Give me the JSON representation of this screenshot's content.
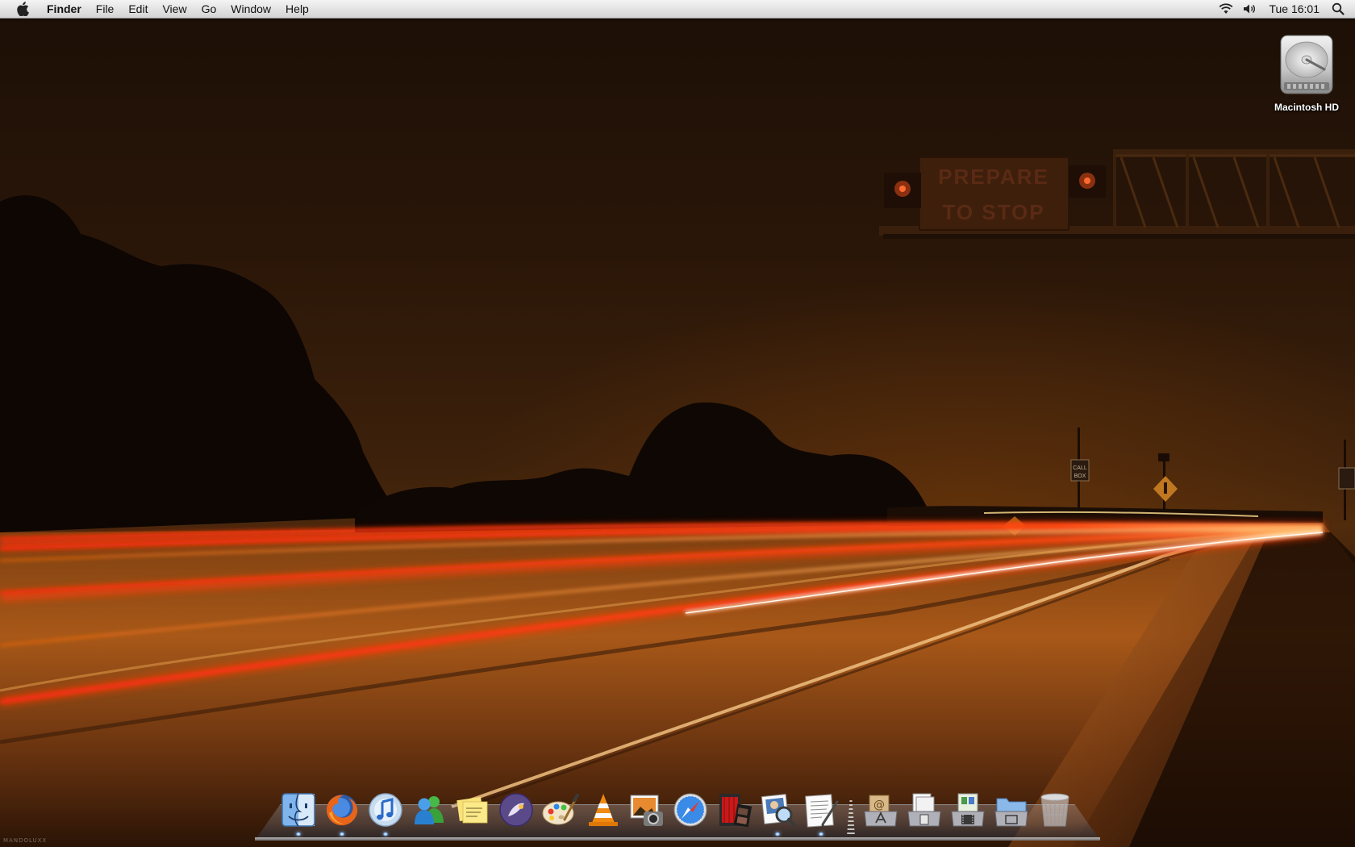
{
  "menubar": {
    "apple_icon": "apple-logo",
    "app_name": "Finder",
    "menus": [
      "File",
      "Edit",
      "View",
      "Go",
      "Window",
      "Help"
    ],
    "status_icons": [
      "wifi-icon",
      "volume-icon"
    ],
    "clock": "Tue 16:01",
    "spotlight_icon": "spotlight-search-icon"
  },
  "desktop": {
    "icons": [
      {
        "label": "Macintosh HD",
        "icon": "hard-drive-icon"
      }
    ],
    "wallpaper": {
      "sign_line1": "PREPARE",
      "sign_line2": "TO STOP",
      "call_box_line1": "CALL",
      "call_box_line2": "BOX"
    },
    "watermark": "MANDOLUXX"
  },
  "dock": {
    "apps": [
      {
        "icon": "finder-icon",
        "running": true
      },
      {
        "icon": "firefox-icon",
        "running": true
      },
      {
        "icon": "itunes-icon",
        "running": true
      },
      {
        "icon": "messenger-icon",
        "running": false
      },
      {
        "icon": "stickies-icon",
        "running": false
      },
      {
        "icon": "kobo-icon",
        "running": false
      },
      {
        "icon": "paintbrush-icon",
        "running": false
      },
      {
        "icon": "vlc-icon",
        "running": false
      },
      {
        "icon": "image-capture-icon",
        "running": false
      },
      {
        "icon": "safari-icon",
        "running": false
      },
      {
        "icon": "movie-maker-icon",
        "running": false
      },
      {
        "icon": "preview-icon",
        "running": true
      },
      {
        "icon": "textedit-icon",
        "running": true
      }
    ],
    "stacks": [
      {
        "icon": "applications-stack-icon"
      },
      {
        "icon": "documents-stack-icon"
      },
      {
        "icon": "downloads-stack-icon"
      },
      {
        "icon": "folder-stack-icon"
      },
      {
        "icon": "trash-icon"
      }
    ]
  },
  "colors": {
    "menubar_bg": "#e4e4e4",
    "sky": "#2a1608",
    "light_trail_red": "#ff3a10",
    "light_trail_orange": "#ff8a20",
    "road": "#b0601c"
  }
}
